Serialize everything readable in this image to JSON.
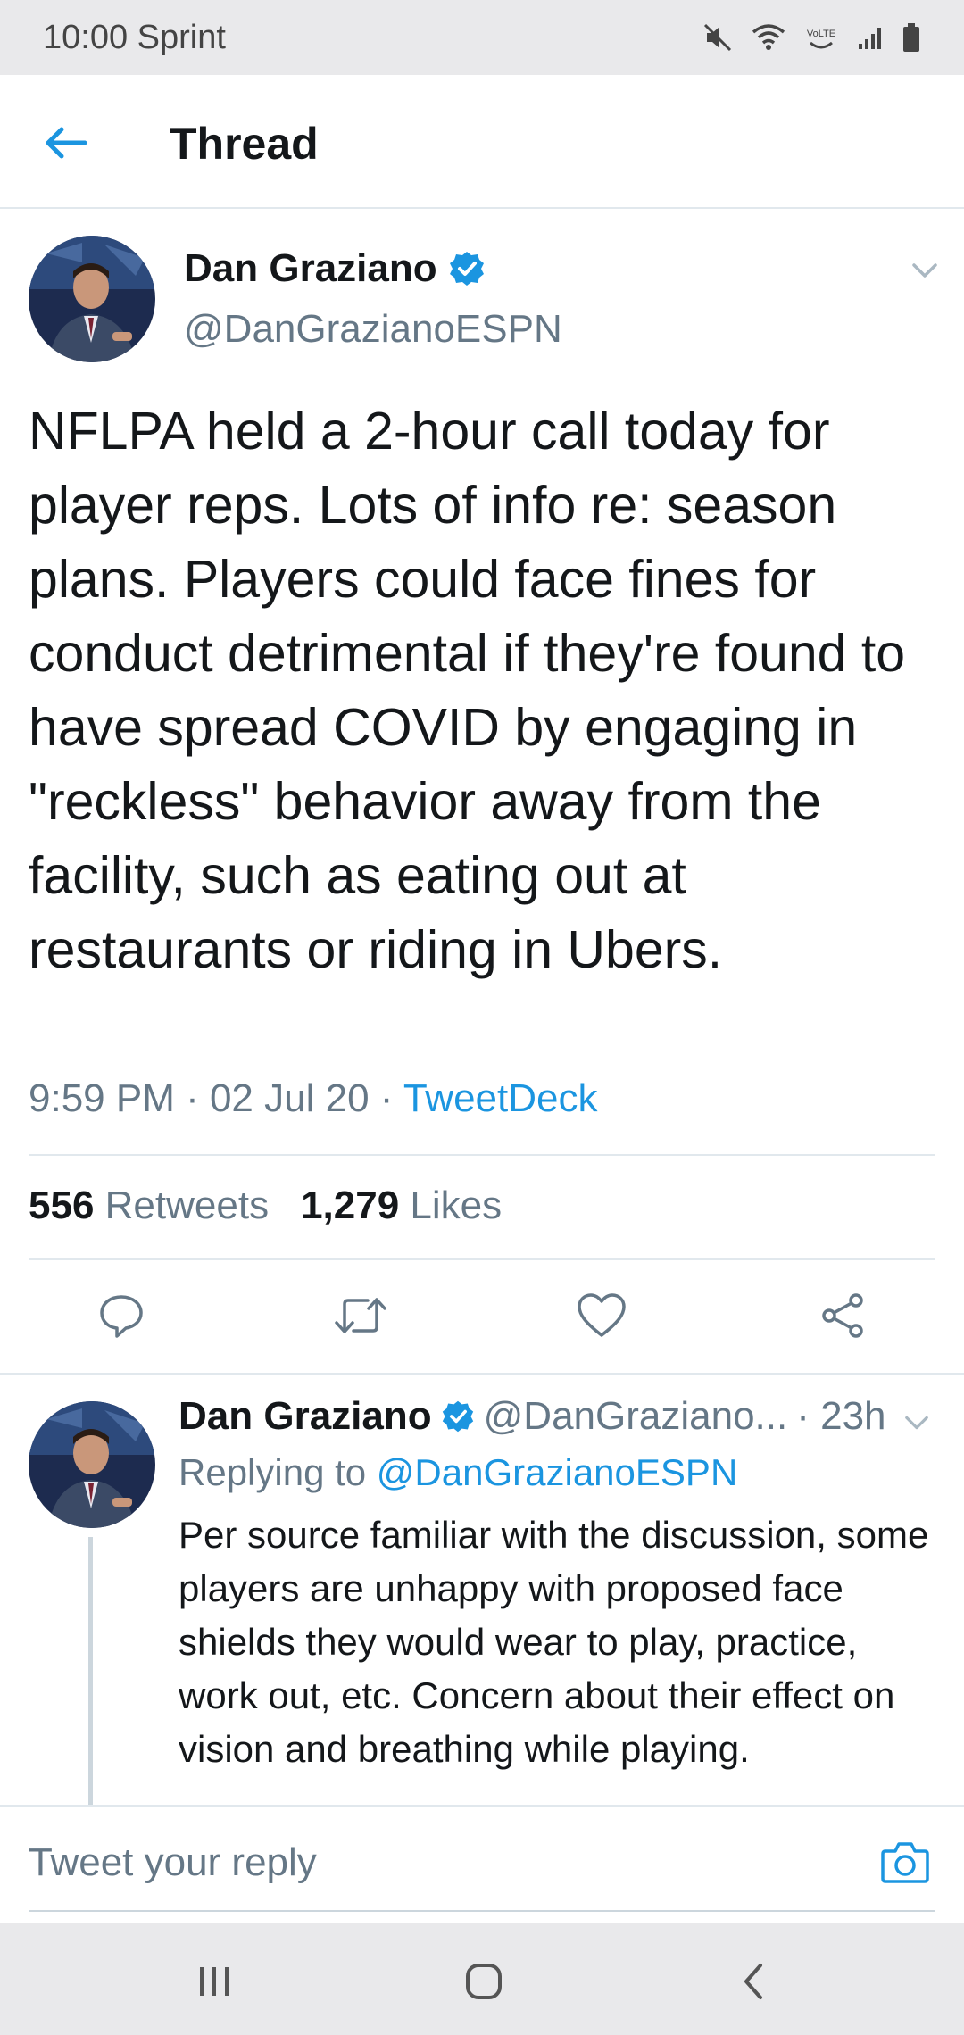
{
  "status_bar": {
    "time_carrier": "10:00 Sprint",
    "volte_label": "VoLTE"
  },
  "header": {
    "title": "Thread"
  },
  "tweet": {
    "author_name": "Dan Graziano",
    "handle": "@DanGrazianoESPN",
    "verified": true,
    "text": "NFLPA held a 2-hour call today for player reps. Lots of info re: season plans. Players could face fines for conduct detrimental if they're found to have spread COVID by engaging in \"reckless\" behavior away from the facility, such as eating out at restaurants or riding in Ubers.",
    "time": "9:59 PM · 02 Jul 20 · ",
    "source": "TweetDeck",
    "retweets_count": "556",
    "retweets_label": "Retweets",
    "likes_count": "1,279",
    "likes_label": "Likes"
  },
  "reply": {
    "author_name": "Dan Graziano",
    "handle": "@DanGraziano...",
    "age": "· 23h",
    "replying_prefix": "Replying to ",
    "replying_to": "@DanGrazianoESPN",
    "text": "Per source familiar with the discussion, some players are unhappy with proposed face shields they would wear to play, practice, work out, etc. Concern about their effect on vision and breathing while playing."
  },
  "composer": {
    "placeholder": "Tweet your reply"
  },
  "colors": {
    "accent": "#1b95e0",
    "text": "#14171a",
    "muted": "#657786",
    "divider": "#e1e8ed"
  }
}
